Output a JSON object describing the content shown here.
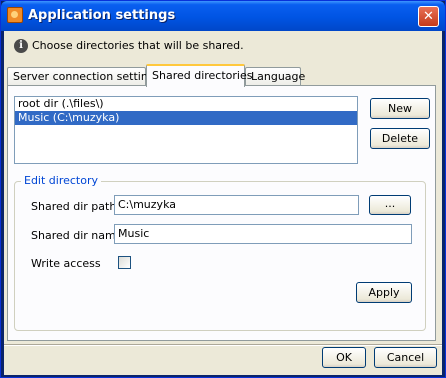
{
  "window": {
    "title": "Application settings",
    "close_label": "✕"
  },
  "info": {
    "icon_glyph": "i",
    "text": "Choose directories that will be shared."
  },
  "tabs": [
    {
      "label": "Server connection settings",
      "active": false
    },
    {
      "label": "Shared directories",
      "active": true
    },
    {
      "label": "Language",
      "active": false
    }
  ],
  "shared_list": {
    "items": [
      {
        "label": "root dir (.\\files\\)",
        "selected": false
      },
      {
        "label": "Music (C:\\muzyka)",
        "selected": true
      }
    ]
  },
  "list_buttons": {
    "new_label": "New",
    "delete_label": "Delete"
  },
  "edit": {
    "group_title": "Edit directory",
    "path_label": "Shared dir path",
    "path_value": "C:\\muzyka",
    "browse_label": "...",
    "name_label": "Shared dir name",
    "name_value": "Music",
    "write_label": "Write access",
    "write_checked": false,
    "apply_label": "Apply"
  },
  "footer": {
    "ok_label": "OK",
    "cancel_label": "Cancel"
  }
}
